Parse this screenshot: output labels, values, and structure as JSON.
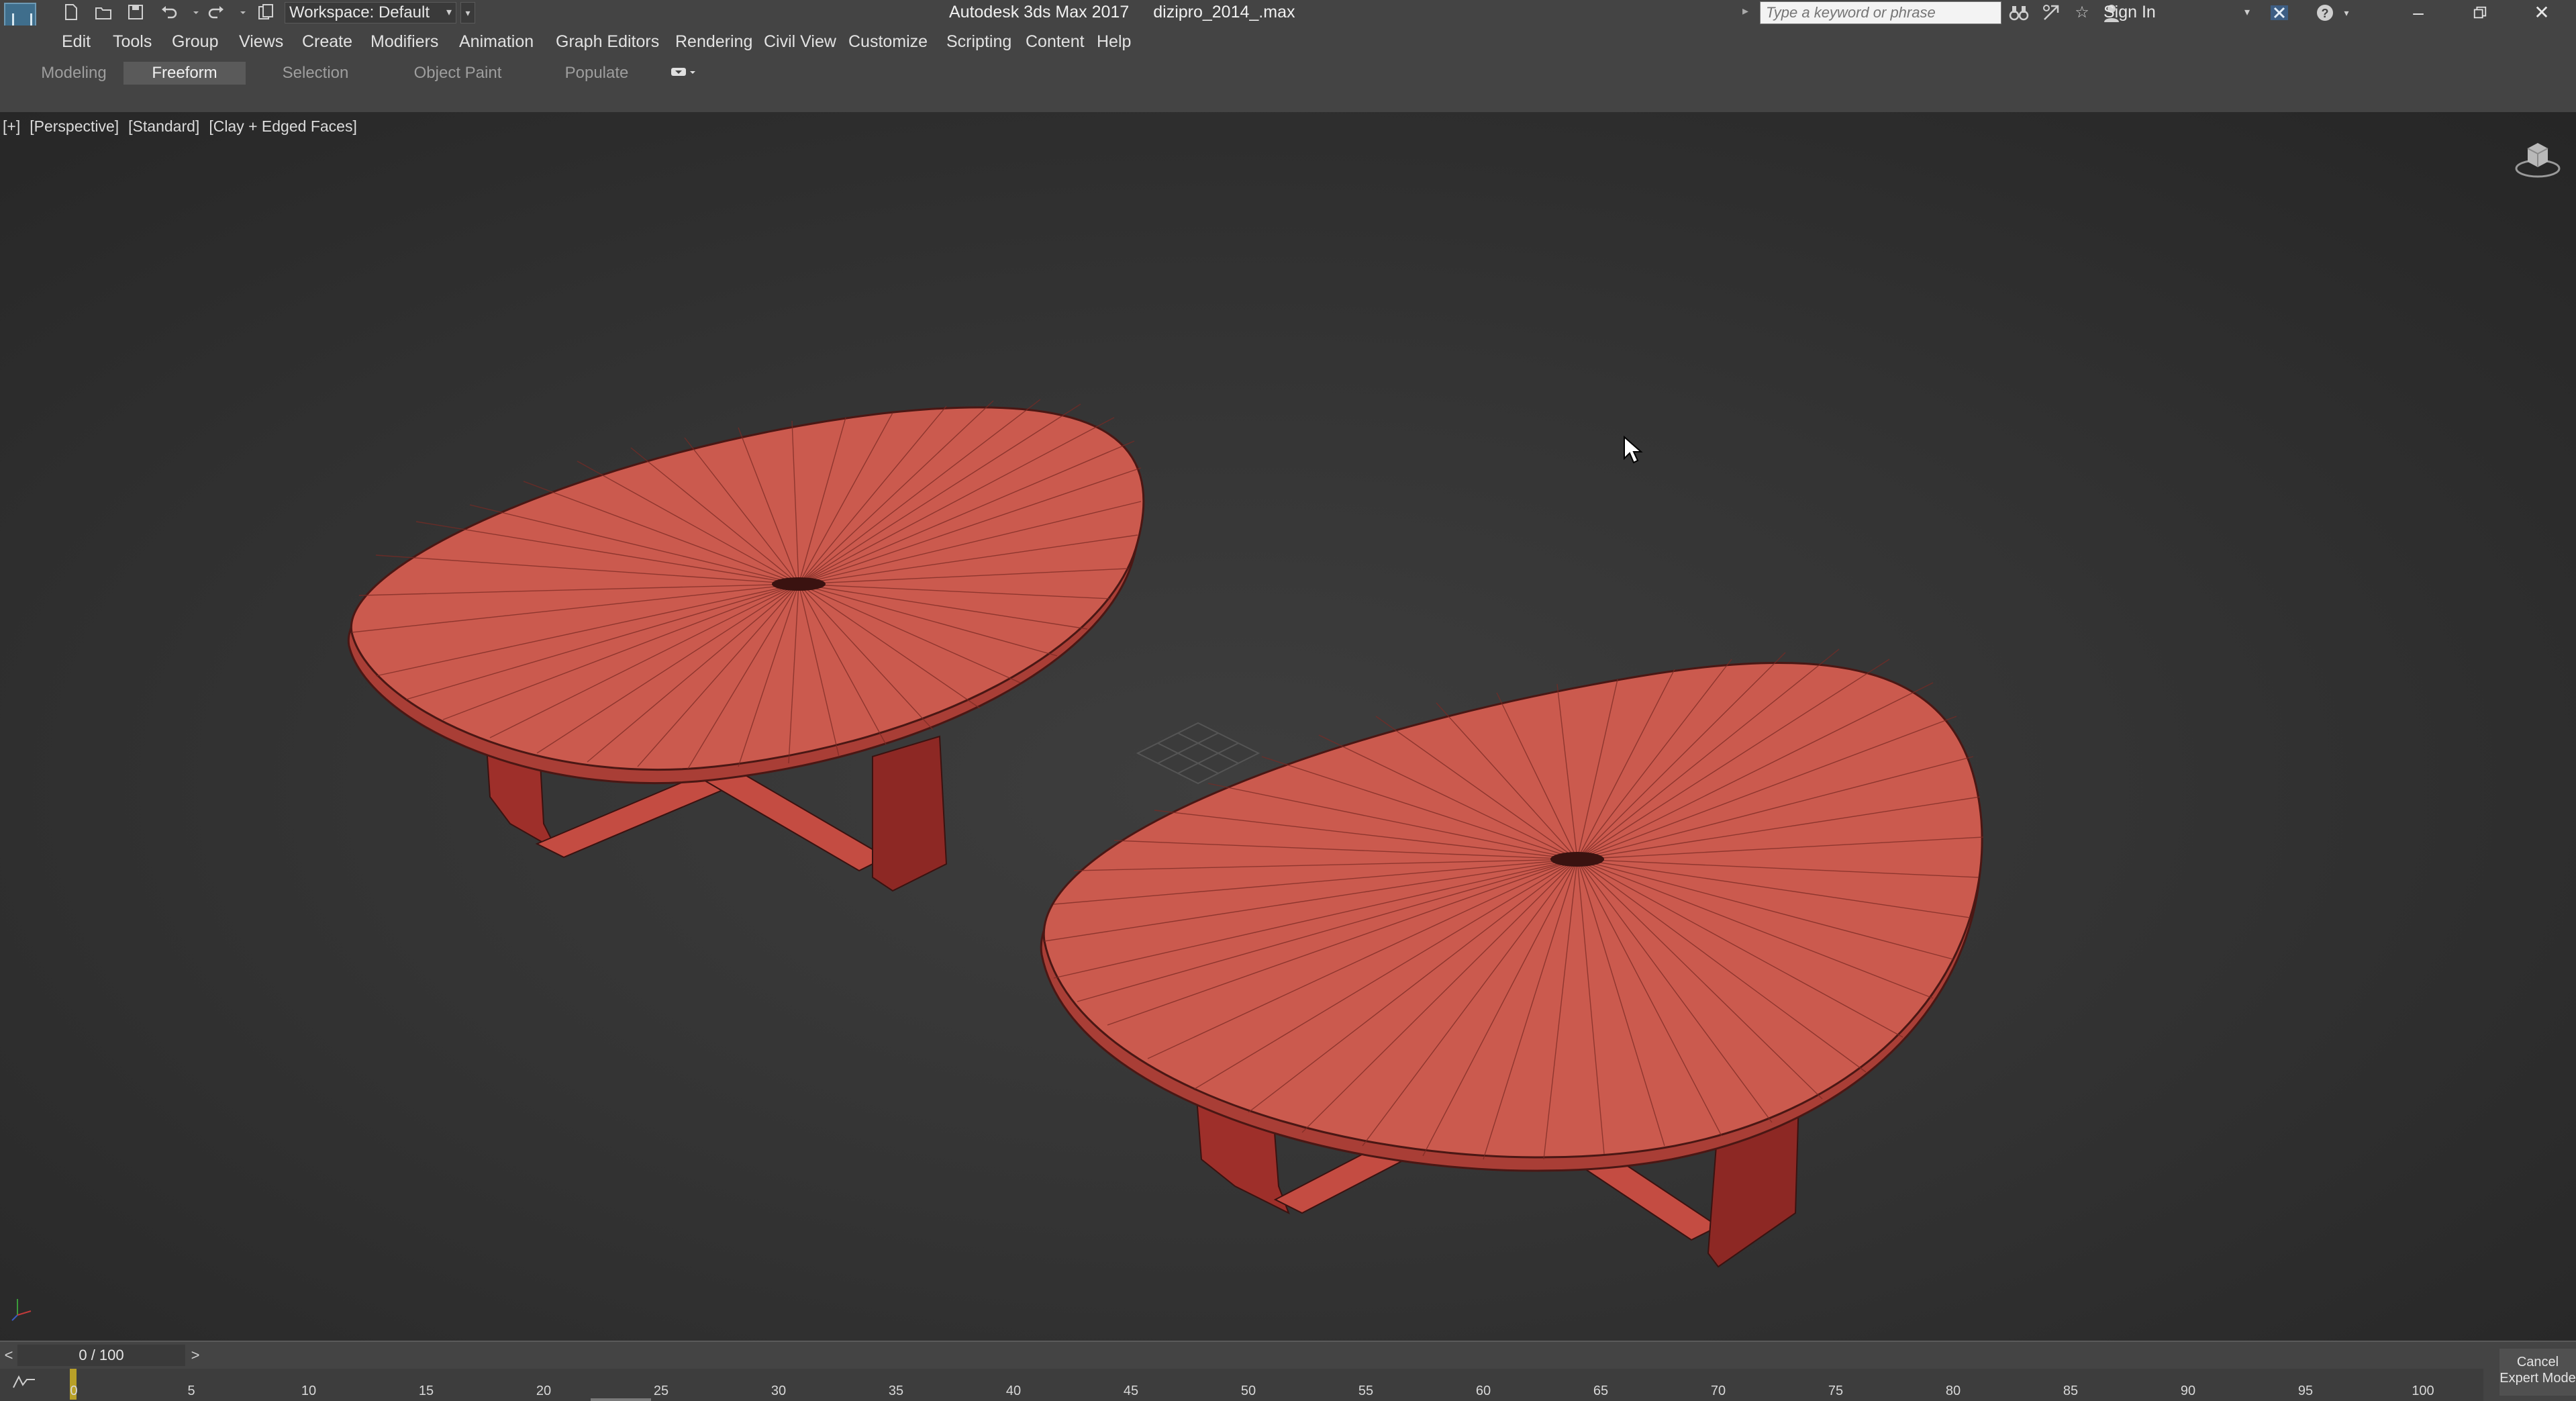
{
  "titlebar": {
    "workspace_label": "Workspace: Default",
    "app_title": "Autodesk 3ds Max 2017",
    "file_name": "dizipro_2014_.max",
    "search_placeholder": "Type a keyword or phrase",
    "sign_in": "Sign In",
    "icons": [
      "new-file-icon",
      "open-file-icon",
      "save-icon",
      "undo-icon",
      "redo-icon",
      "project-icon",
      "binoculars-icon",
      "subscription-icon",
      "favorites-star-icon",
      "user-icon",
      "close-x-tool-icon",
      "help-icon"
    ]
  },
  "menu": {
    "items": [
      "Edit",
      "Tools",
      "Group",
      "Views",
      "Create",
      "Modifiers",
      "Animation",
      "Graph Editors",
      "Rendering",
      "Civil View",
      "Customize",
      "Scripting",
      "Content",
      "Help"
    ]
  },
  "ribbon": {
    "tabs": [
      "Modeling",
      "Freeform",
      "Selection",
      "Object Paint",
      "Populate"
    ],
    "active_tab": "Freeform"
  },
  "viewport": {
    "labels": [
      "[+]",
      "[Perspective]",
      "[Standard]",
      "[Clay + Edged Faces]"
    ],
    "object_color": "#c8544a",
    "background_color": "#333333"
  },
  "timeline": {
    "current": "0 / 100",
    "prev": "<",
    "next": ">",
    "ticks": [
      "0",
      "5",
      "10",
      "15",
      "20",
      "25",
      "30",
      "35",
      "40",
      "45",
      "50",
      "55",
      "60",
      "65",
      "70",
      "75",
      "80",
      "85",
      "90",
      "95",
      "100"
    ],
    "cancel_line1": "Cancel",
    "cancel_line2": "Expert Mode",
    "marker_color": "#b8a028"
  }
}
